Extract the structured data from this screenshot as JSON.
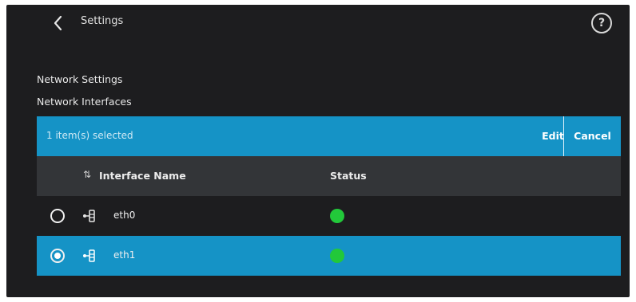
{
  "header": {
    "title": "Settings"
  },
  "sections": {
    "network_settings": "Network Settings",
    "network_interfaces": "Network Interfaces"
  },
  "selection_bar": {
    "text": "1 item(s) selected",
    "edit_label": "Edit",
    "cancel_label": "Cancel"
  },
  "table": {
    "columns": {
      "interface_name": "Interface Name",
      "status": "Status"
    },
    "rows": [
      {
        "name": "eth0",
        "selected": false,
        "status": "up"
      },
      {
        "name": "eth1",
        "selected": true,
        "status": "up"
      }
    ]
  },
  "colors": {
    "accent": "#1593c6",
    "status_ok": "#22c83a",
    "background": "#1d1d1f",
    "header_row": "#333538"
  },
  "icons": [
    "chevron-left-icon",
    "help-circle-icon",
    "sort-icon",
    "network-interface-icon"
  ]
}
